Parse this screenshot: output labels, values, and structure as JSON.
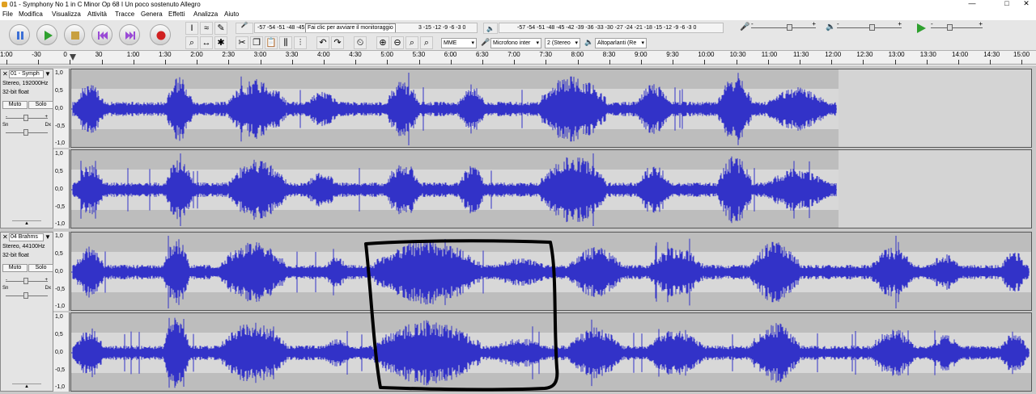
{
  "window": {
    "title": "01 - Symphony No 1 in C Minor Op 68 I Un poco sostenuto Allegro",
    "minimize": "—",
    "maximize": "□",
    "close": "✕"
  },
  "menu": [
    "File",
    "Modifica",
    "Visualizza",
    "Attività",
    "Tracce",
    "Genera",
    "Effetti",
    "Analizza",
    "Aiuto"
  ],
  "toolbar": {
    "transport": [
      "pause-icon",
      "play-icon",
      "stop-icon",
      "skip-start-icon",
      "skip-end-icon",
      "record-icon"
    ],
    "record_meter": {
      "lr": "Sn\nDx",
      "scale": "-57 -54 -51 -48 -45",
      "hint": "Fai clic per avviare il monitoraggio",
      "scale_end": "3 -15 -12 -9 -6 -3 0"
    },
    "play_meter": {
      "lr": "Sn\nDx",
      "scale": "-57 -54 -51 -48 -45 -42 -39 -36 -33 -30 -27 -24 -21 -18 -15 -12 -9 -6 -3 0"
    },
    "host": "MME",
    "input": "Microfono inter",
    "channels": "2 (Stereo",
    "output": "Altoparlanti (Re",
    "rec_slider": {
      "minus": "-",
      "plus": "+",
      "level": 0.6
    },
    "play_slider": {
      "minus": "-",
      "plus": "+",
      "level": 0.55
    },
    "speed_slider": {
      "minus": "-",
      "plus": "+",
      "level": 0.35
    }
  },
  "ruler": {
    "labels": [
      "1:00",
      "-30",
      "0",
      "30",
      "1:00",
      "1:30",
      "2:00",
      "2:30",
      "3:00",
      "3:30",
      "4:00",
      "4:30",
      "5:00",
      "5:30",
      "6:00",
      "6:30",
      "7:00",
      "7:30",
      "8:00",
      "8:30",
      "9:00",
      "9:30",
      "10:00",
      "10:30",
      "11:00",
      "11:30",
      "12:00",
      "12:30",
      "13:00",
      "13:30",
      "14:00",
      "14:30",
      "15:00"
    ]
  },
  "tracks": [
    {
      "name": "01 - Symph",
      "rate": "Stereo, 192000Hz",
      "format": "32-bit float",
      "mute": "Muto",
      "solo": "Solo",
      "gain_minus": "-",
      "gain_plus": "+",
      "pan_left": "Sn",
      "pan_right": "Dx",
      "duration_fraction": 0.8,
      "scale": [
        "1,0",
        "0,5",
        "0,0",
        "-0,5",
        "-1,0"
      ]
    },
    {
      "name": "04 Brahms",
      "rate": "Stereo, 44100Hz",
      "format": "32-bit float",
      "mute": "Muto",
      "solo": "Solo",
      "gain_minus": "-",
      "gain_plus": "+",
      "pan_left": "Sn",
      "pan_right": "Dx",
      "duration_fraction": 1.0,
      "scale": [
        "1,0",
        "0,5",
        "0,0",
        "-0,5",
        "-1,0"
      ]
    }
  ],
  "colors": {
    "waveform": "#3232c8",
    "clip_bg": "#bdbdbd",
    "clip_band": "#d8d8d8",
    "annotation": "#000000"
  }
}
